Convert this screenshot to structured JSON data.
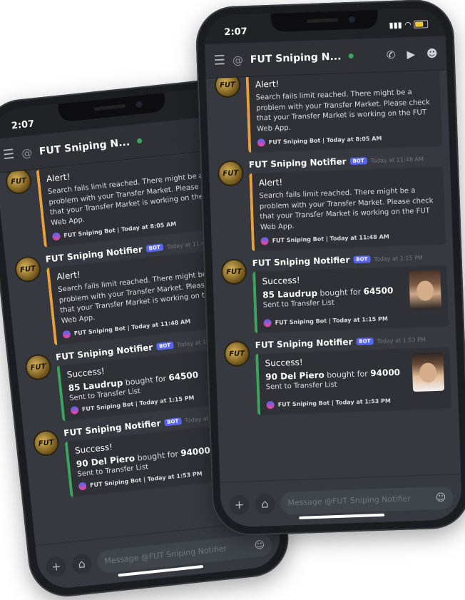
{
  "status": {
    "time": "2:07"
  },
  "header": {
    "at_symbol": "@",
    "channel_name": "FUT Sniping N..."
  },
  "messages": {
    "alert1": {
      "title": "Alert!",
      "description": "Search fails limit reached. There might be a problem with your Transfer Market. Please check that your Transfer Market is working on the FUT Web App.",
      "footer": "FUT Sniping Bot | Today at 8:05 AM"
    },
    "alert2": {
      "author": "FUT Sniping Notifier",
      "badge": "BOT",
      "timestamp": "Today at 11:48 AM",
      "title": "Alert!",
      "description": "Search fails limit reached. There might be a problem with your Transfer Market. Please check that your Transfer Market is working on the FUT Web App.",
      "footer": "FUT Sniping Bot | Today at 11:48 AM"
    },
    "success1": {
      "author": "FUT Sniping Notifier",
      "badge": "BOT",
      "timestamp": "Today at 1:15 PM",
      "title": "Success!",
      "player": "85 Laudrup",
      "bought_for": "bought for",
      "price": "64500",
      "sent": "Sent to Transfer List",
      "footer": "FUT Sniping Bot | Today at 1:15 PM"
    },
    "success2": {
      "author": "FUT Sniping Notifier",
      "badge": "BOT",
      "timestamp": "Today at 1:53 PM",
      "title": "Success!",
      "player": "90 Del Piero",
      "bought_for": "bought for",
      "price": "94000",
      "sent": "Sent to Transfer List",
      "footer": "FUT Sniping Bot | Today at 1:53 PM"
    }
  },
  "composer": {
    "placeholder": "Message @FUT Sniping Notifier"
  },
  "avatar_text": "FUT",
  "colors": {
    "alert_bar": "#e9a03b",
    "success_bar": "#3ba55d",
    "bot_badge": "#5865f2",
    "online": "#3ba55d",
    "background": "#36393f"
  }
}
